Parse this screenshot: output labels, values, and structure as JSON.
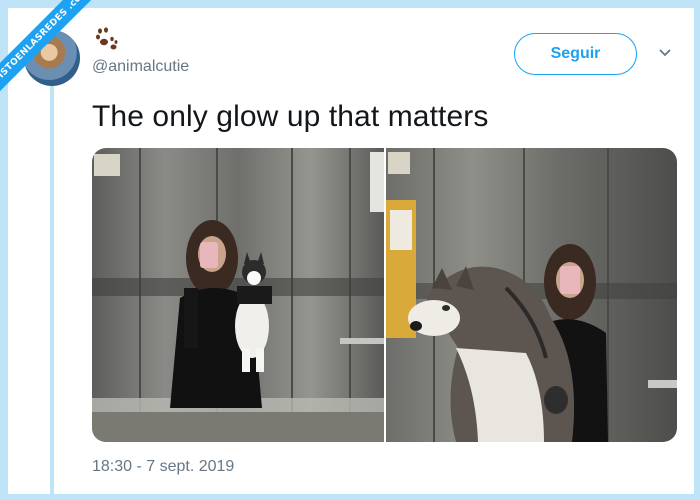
{
  "watermark": {
    "text": "VISTOENLASREDES .com"
  },
  "tweet": {
    "handle": "@animalcutie",
    "follow_label": "Seguir",
    "text": "The only glow up that matters",
    "timestamp": "18:30 - 7 sept. 2019"
  },
  "icons": {
    "avatar": "profile-avatar",
    "paw": "paw-icon",
    "more": "chevron-down-icon"
  },
  "colors": {
    "accent": "#1da1f2",
    "frame": "#bfe3f7",
    "secondary_text": "#657786",
    "primary_text": "#14171a"
  },
  "media": [
    {
      "name": "photo-small-puppy",
      "alt": ""
    },
    {
      "name": "photo-grown-husky",
      "alt": ""
    }
  ]
}
